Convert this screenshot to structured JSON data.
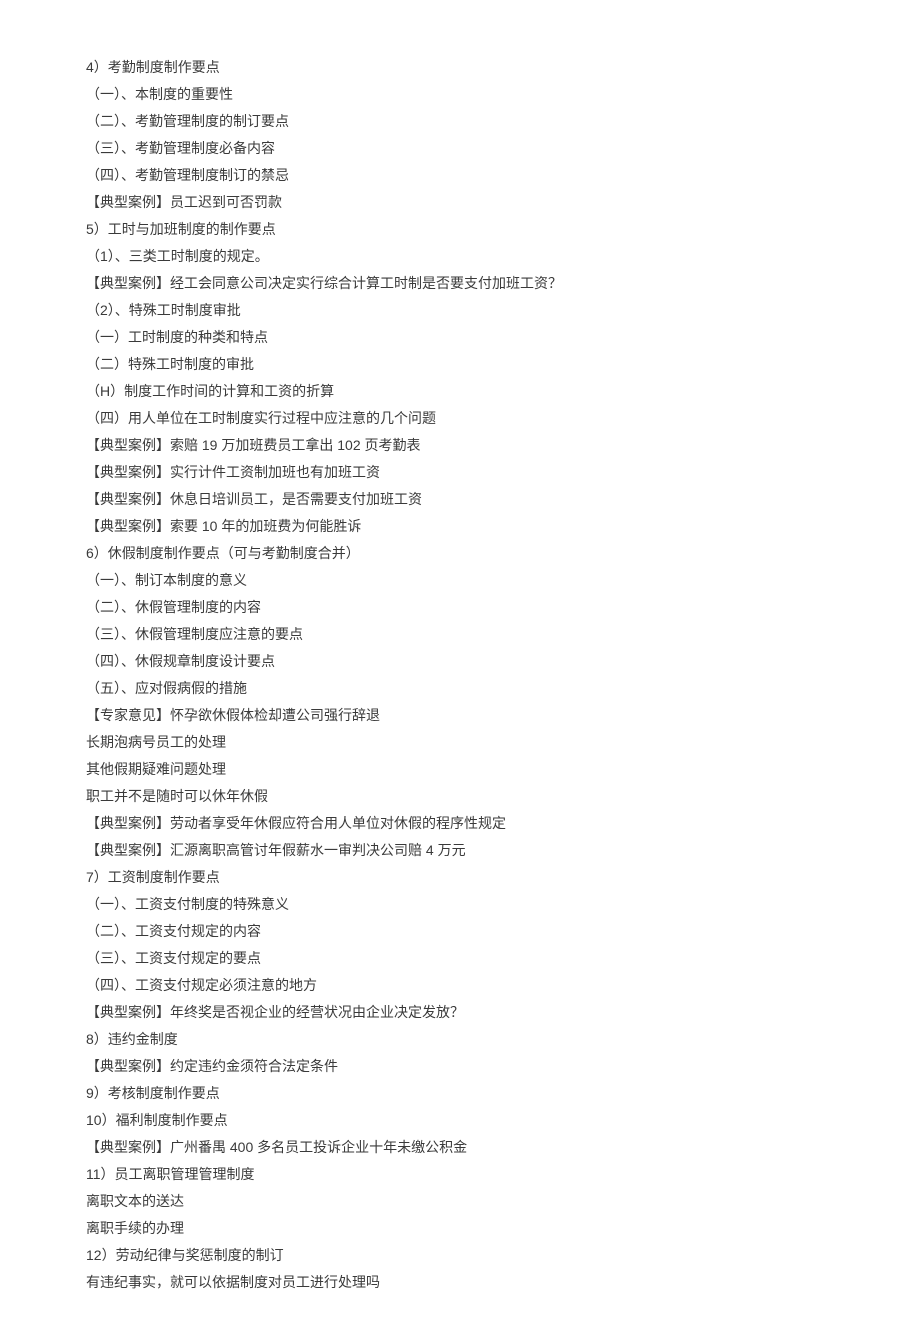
{
  "lines": [
    "4）考勤制度制作要点",
    "（一）、本制度的重要性",
    "（二）、考勤管理制度的制订要点",
    "（三）、考勤管理制度必备内容",
    "（四）、考勤管理制度制订的禁忌",
    "【典型案例】员工迟到可否罚款",
    "5）工时与加班制度的制作要点",
    "（1）、三类工时制度的规定。",
    "【典型案例】经工会同意公司决定实行综合计算工时制是否要支付加班工资？",
    "（2）、特殊工时制度审批",
    "（一）工时制度的种类和特点",
    "（二）特殊工时制度的审批",
    "（H）制度工作时间的计算和工资的折算",
    "（四）用人单位在工时制度实行过程中应注意的几个问题",
    "【典型案例】索赔 19 万加班费员工拿出 102 页考勤表",
    "【典型案例】实行计件工资制加班也有加班工资",
    "【典型案例】休息日培训员工，是否需要支付加班工资",
    "【典型案例】索要 10 年的加班费为何能胜诉",
    "6）休假制度制作要点（可与考勤制度合并）",
    "（一）、制订本制度的意义",
    "（二）、休假管理制度的内容",
    "（三）、休假管理制度应注意的要点",
    "（四）、休假规章制度设计要点",
    "（五）、应对假病假的措施",
    "【专家意见】怀孕欲休假体检却遭公司强行辞退",
    "长期泡病号员工的处理",
    "其他假期疑难问题处理",
    "职工并不是随时可以休年休假",
    "【典型案例】劳动者享受年休假应符合用人单位对休假的程序性规定",
    "【典型案例】汇源离职高管讨年假薪水一审判决公司赔 4 万元",
    "7）工资制度制作要点",
    "（一）、工资支付制度的特殊意义",
    "（二）、工资支付规定的内容",
    "（三）、工资支付规定的要点",
    "（四）、工资支付规定必须注意的地方",
    "【典型案例】年终奖是否视企业的经营状况由企业决定发放？",
    "8）违约金制度",
    "【典型案例】约定违约金须符合法定条件",
    "9）考核制度制作要点",
    "10）福利制度制作要点",
    "【典型案例】广州番禺 400 多名员工投诉企业十年未缴公积金",
    "11）员工离职管理管理制度",
    "离职文本的送达",
    "离职手续的办理",
    "12）劳动纪律与奖惩制度的制订",
    "有违纪事实，就可以依据制度对员工进行处理吗"
  ]
}
